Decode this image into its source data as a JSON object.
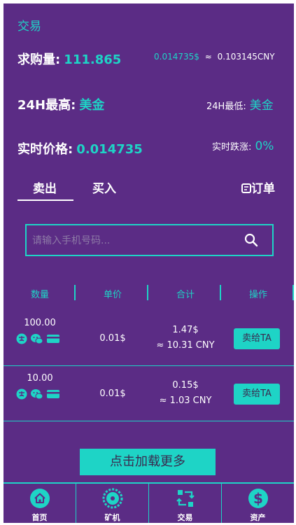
{
  "header": {
    "title": "交易"
  },
  "stats": {
    "purchase_label": "求购量:",
    "purchase_value": "111.865",
    "rate_usd": "0.014735$",
    "approx": "≈",
    "rate_cny": "0.103145CNY",
    "high_label": "24H最高:",
    "high_value": "美金",
    "low_label": "24H最低:",
    "low_value": "美金",
    "price_label": "实时价格:",
    "price_value": "0.014735",
    "change_label": "实时跌涨:",
    "change_value": "0%"
  },
  "tabs": {
    "sell": "卖出",
    "buy": "买入",
    "orders": "订单"
  },
  "search": {
    "placeholder": "请输入手机号码..."
  },
  "table": {
    "columns": [
      "数量",
      "单价",
      "合计",
      "操作"
    ],
    "rows": [
      {
        "qty": "100.00",
        "price": "0.01$",
        "total_usd": "1.47$",
        "total_cny": "≈ 10.31 CNY",
        "action": "卖给TA"
      },
      {
        "qty": "10.00",
        "price": "0.01$",
        "total_usd": "0.15$",
        "total_cny": "≈ 1.03 CNY",
        "action": "卖给TA"
      }
    ]
  },
  "load_more": "点击加载更多",
  "nav": [
    {
      "label": "首页",
      "icon": "home-icon"
    },
    {
      "label": "矿机",
      "icon": "miner-icon"
    },
    {
      "label": "交易",
      "icon": "exchange-icon"
    },
    {
      "label": "资产",
      "icon": "dollar-icon"
    }
  ],
  "colors": {
    "background": "#5b2c85",
    "accent": "#1ed4c6",
    "text": "#ffffff"
  }
}
